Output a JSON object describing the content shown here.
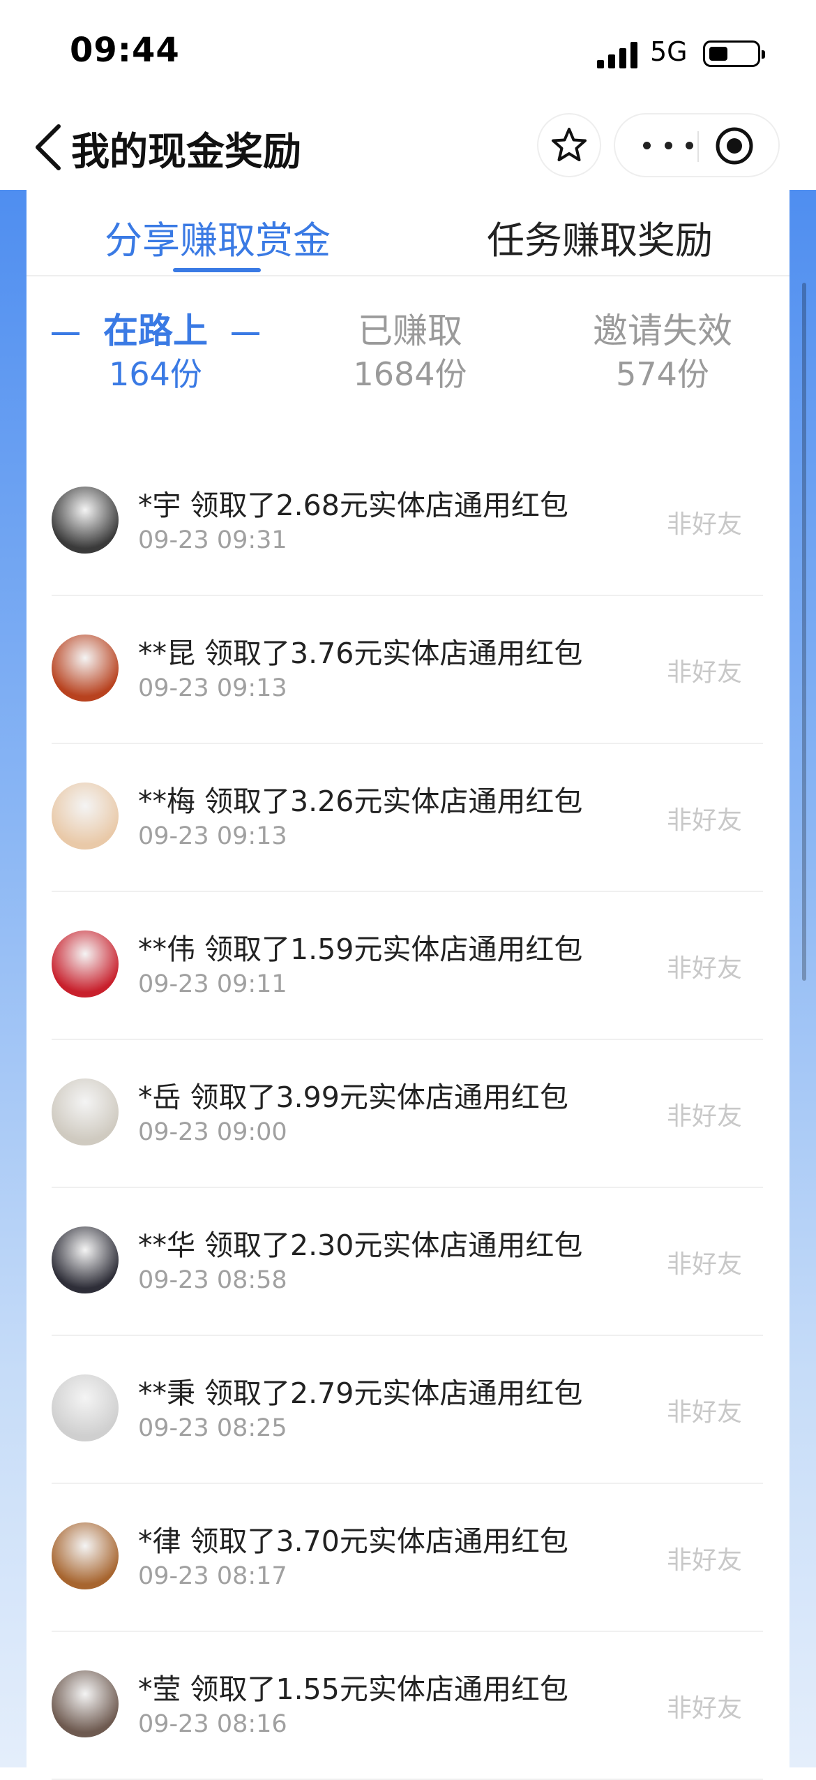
{
  "status_bar": {
    "time": "09:44",
    "network": "5G"
  },
  "header": {
    "title": "我的现金奖励"
  },
  "tabs": [
    {
      "label": "分享赚取赏金",
      "active": true
    },
    {
      "label": "任务赚取奖励",
      "active": false
    }
  ],
  "subtabs": [
    {
      "label": "在路上",
      "count": "164份",
      "active": true
    },
    {
      "label": "已赚取",
      "count": "1684份",
      "active": false
    },
    {
      "label": "邀请失效",
      "count": "574份",
      "active": false
    }
  ],
  "records": [
    {
      "text": "*宇 领取了2.68元实体店通用红包",
      "time": "09-23 09:31",
      "tag": "非好友",
      "avatar_color": "#3a3a3a"
    },
    {
      "text": "**昆 领取了3.76元实体店通用红包",
      "time": "09-23 09:13",
      "tag": "非好友",
      "avatar_color": "#b8421f"
    },
    {
      "text": "**梅 领取了3.26元实体店通用红包",
      "time": "09-23 09:13",
      "tag": "非好友",
      "avatar_color": "#e9c9a8"
    },
    {
      "text": "**伟 领取了1.59元实体店通用红包",
      "time": "09-23 09:11",
      "tag": "非好友",
      "avatar_color": "#c8202c"
    },
    {
      "text": "*岳 领取了3.99元实体店通用红包",
      "time": "09-23 09:00",
      "tag": "非好友",
      "avatar_color": "#cfcac0"
    },
    {
      "text": "**华 领取了2.30元实体店通用红包",
      "time": "09-23 08:58",
      "tag": "非好友",
      "avatar_color": "#2e2e38"
    },
    {
      "text": "**秉 领取了2.79元实体店通用红包",
      "time": "09-23 08:25",
      "tag": "非好友",
      "avatar_color": "#cfcfcf"
    },
    {
      "text": "*律 领取了3.70元实体店通用红包",
      "time": "09-23 08:17",
      "tag": "非好友",
      "avatar_color": "#a7652f"
    },
    {
      "text": "*莹 领取了1.55元实体店通用红包",
      "time": "09-23 08:16",
      "tag": "非好友",
      "avatar_color": "#6e5a50"
    }
  ],
  "colors": {
    "accent": "#3a7ae4",
    "muted": "#9a9a9a",
    "tag": "#c8c8c8"
  }
}
